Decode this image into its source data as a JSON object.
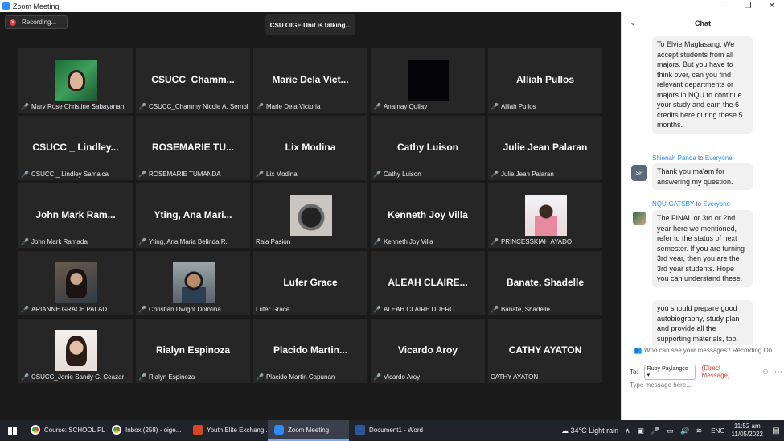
{
  "window": {
    "title": "Zoom Meeting"
  },
  "recording": {
    "label": "Recording..."
  },
  "talking": {
    "text": "CSU OIGE Unit is talking..."
  },
  "tiles": [
    {
      "display": "",
      "label": "Mary Rose Christine Sabayanan",
      "muted": true,
      "photo": "greenframe"
    },
    {
      "display": "CSUCC_Chamm...",
      "label": "CSUCC_Chammy Nicole A. Sembl...",
      "muted": true,
      "photo": ""
    },
    {
      "display": "Marie Dela Vict...",
      "label": "Marie Dela Victoria",
      "muted": true,
      "photo": ""
    },
    {
      "display": "",
      "label": "Anamay Quilay",
      "muted": true,
      "photo": "dark"
    },
    {
      "display": "Alliah Pullos",
      "label": "Alliah Pullos",
      "muted": true,
      "photo": ""
    },
    {
      "display": "CSUCC _ Lindley...",
      "label": "CSUCC _ Lindley Samalca",
      "muted": true,
      "photo": ""
    },
    {
      "display": "ROSEMARIE TU...",
      "label": "ROSEMARIE TUMANDA",
      "muted": true,
      "photo": ""
    },
    {
      "display": "Lix Modina",
      "label": "Lix Modina",
      "muted": true,
      "photo": ""
    },
    {
      "display": "Cathy Luison",
      "label": "Cathy Luison",
      "muted": true,
      "photo": ""
    },
    {
      "display": "Julie Jean Palaran",
      "label": "Julie Jean Palaran",
      "muted": true,
      "photo": ""
    },
    {
      "display": "John Mark Ram...",
      "label": "John Mark Ramada",
      "muted": true,
      "photo": ""
    },
    {
      "display": "Yting, Ana Mari...",
      "label": "Yting, Ana Maria Belinda R.",
      "muted": true,
      "photo": ""
    },
    {
      "display": "",
      "label": "Raia Pasion",
      "muted": false,
      "photo": "cam"
    },
    {
      "display": "Kenneth Joy Villa",
      "label": "Kenneth Joy Villa",
      "muted": true,
      "photo": ""
    },
    {
      "display": "",
      "label": "PRINCESSKIAH AYADO",
      "muted": true,
      "photo": "pink"
    },
    {
      "display": "",
      "label": "ARIANNE GRACE PALAD",
      "muted": true,
      "photo": "girl"
    },
    {
      "display": "",
      "label": "Christian Dwight Dolotina",
      "muted": true,
      "photo": "boy"
    },
    {
      "display": "Lufer Grace",
      "label": "Lufer Grace",
      "muted": false,
      "photo": ""
    },
    {
      "display": "ALEAH  CLAIRE...",
      "label": "ALEAH CLAIRE DUERO",
      "muted": true,
      "photo": ""
    },
    {
      "display": "Banate, Shadelle",
      "label": "Banate, Shadelle",
      "muted": true,
      "photo": ""
    },
    {
      "display": "",
      "label": "CSUCC_Jonie Sandy C. Ceazar",
      "muted": true,
      "photo": "lady"
    },
    {
      "display": "Rialyn Espinoza",
      "label": "Rialyn Espinoza",
      "muted": true,
      "photo": ""
    },
    {
      "display": "Placido  Martin...",
      "label": "Placido Martin Capunan",
      "muted": true,
      "photo": ""
    },
    {
      "display": "Vicardo Aroy",
      "label": "Vicardo Aroy",
      "muted": true,
      "photo": ""
    },
    {
      "display": "CATHY AYATON",
      "label": "CATHY AYATON",
      "muted": false,
      "photo": ""
    }
  ],
  "chat": {
    "title": "Chat",
    "message1": "To Elvie Maglasang,  We accept students from all majors. But you have to think over, can you find relevant departments or majors in NQU to continue your study and earn the 6 credits here during these 5 months.",
    "sender2": "Shienah Panda",
    "to_label": "to",
    "everyone": "Everyone",
    "avatar2": "SP",
    "message2": "Thank you ma'am for answering my question.",
    "sender3": "NQU-GATSBY",
    "message3": "The FINAL or 3rd or 2nd year here we mentioned, refer to the status of next semester. If you are turning 3rd year, then you are the 3rd year students. Hope you can understand these.",
    "message4": "you should prepare good autobiography, study plan and provide all the supporting materials, too.",
    "privacy": "Who can see your messages? Recording On",
    "to": "To:",
    "recipient": "Ruby Paylangco",
    "direct": "(Direct Message)",
    "placeholder": "Type message here..."
  },
  "taskbar": {
    "items": [
      {
        "label": "Course: SCHOOL PL...",
        "icon": "chrome"
      },
      {
        "label": "Inbox (258) - oige...",
        "icon": "chrome"
      },
      {
        "label": "Youth Elite Exchang...",
        "icon": "ppt"
      },
      {
        "label": "Zoom Meeting",
        "icon": "zoom"
      },
      {
        "label": "Document1 - Word",
        "icon": "word"
      }
    ],
    "weather": "34°C  Light rain",
    "lang": "ENG",
    "time": "11:52 am",
    "date": "11/05/2022"
  }
}
